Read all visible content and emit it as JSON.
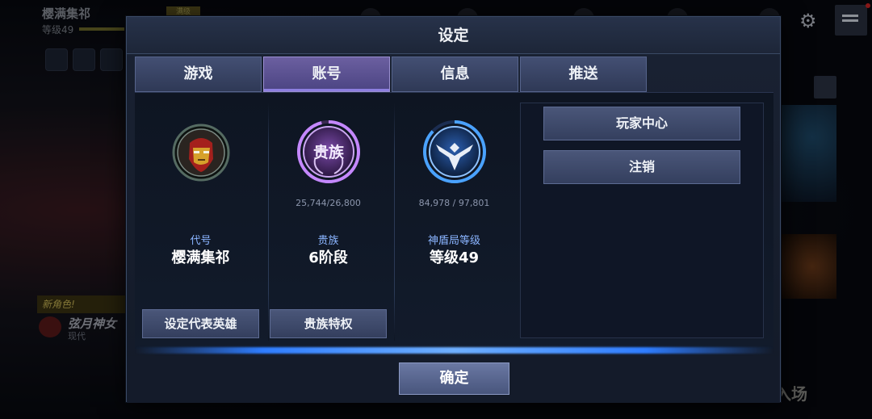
{
  "background": {
    "player_name": "樱满集祁",
    "player_level": "等级49",
    "new_character_label": "新角色!",
    "hero_name": "弦月神女",
    "hero_subtitle": "现代",
    "enter_label": "入场",
    "hero_badge": "满级"
  },
  "modal": {
    "title": "设定",
    "tabs": [
      {
        "label": "游戏",
        "active": false
      },
      {
        "label": "账号",
        "active": true
      },
      {
        "label": "信息",
        "active": false
      },
      {
        "label": "推送",
        "active": false
      }
    ],
    "columns": [
      {
        "emblem": "iron-man-portrait-icon",
        "stat": "",
        "label": "代号",
        "value": "樱满集祁",
        "button": "设定代表英雄"
      },
      {
        "emblem": "nobility-emblem-icon",
        "emblem_text": "贵族",
        "stat": "25,744/26,800",
        "progress": 0.9606,
        "label": "贵族",
        "value": "6阶段",
        "button": "贵族特权"
      },
      {
        "emblem": "shield-eagle-emblem-icon",
        "stat": "84,978 / 97,801",
        "progress": 0.8689,
        "label": "神盾局等级",
        "value": "等级49"
      }
    ],
    "side_buttons": [
      "玩家中心",
      "注销"
    ],
    "confirm": "确定"
  },
  "colors": {
    "accent_purple": "#8d7fe0",
    "accent_blue": "#2f7dff",
    "label_blue": "#8ab4ff",
    "iron_man_green": "#31d46a"
  }
}
